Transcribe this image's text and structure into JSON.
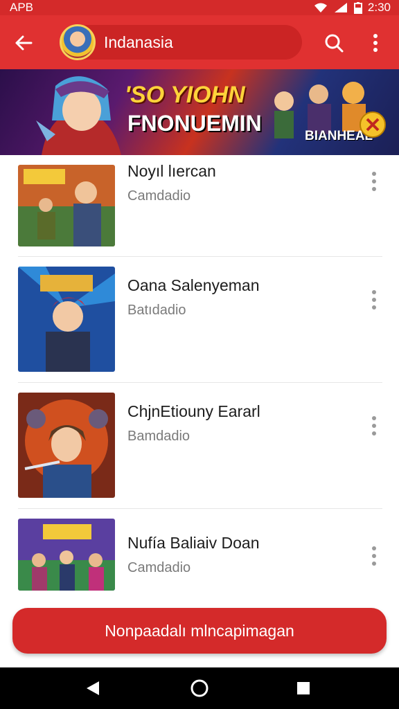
{
  "status_bar": {
    "left_text": "APB",
    "time": "2:30"
  },
  "app_bar": {
    "title": "Indanasia",
    "back_icon": "arrow-left-icon",
    "search_icon": "search-icon",
    "more_icon": "more-vertical-icon"
  },
  "banner": {
    "title": "'SO YIOHN",
    "subtitle": "FNONUEMIN",
    "tag": "BIANHEAL"
  },
  "items": [
    {
      "title": "Noyıl lıercan",
      "subtitle": "Camdadio"
    },
    {
      "title": "Oana Salenyeman",
      "subtitle": "Batıdadio"
    },
    {
      "title": "ChjnEtiouny Eararl",
      "subtitle": "Bamdadio"
    },
    {
      "title": "Nufía Baliaiv Doan",
      "subtitle": "Camdadio"
    }
  ],
  "cta": {
    "label": "Nonpaadalı mlncapimagan"
  },
  "colors": {
    "primary": "#e03131",
    "status": "#d42a2a",
    "nav": "#000000"
  }
}
